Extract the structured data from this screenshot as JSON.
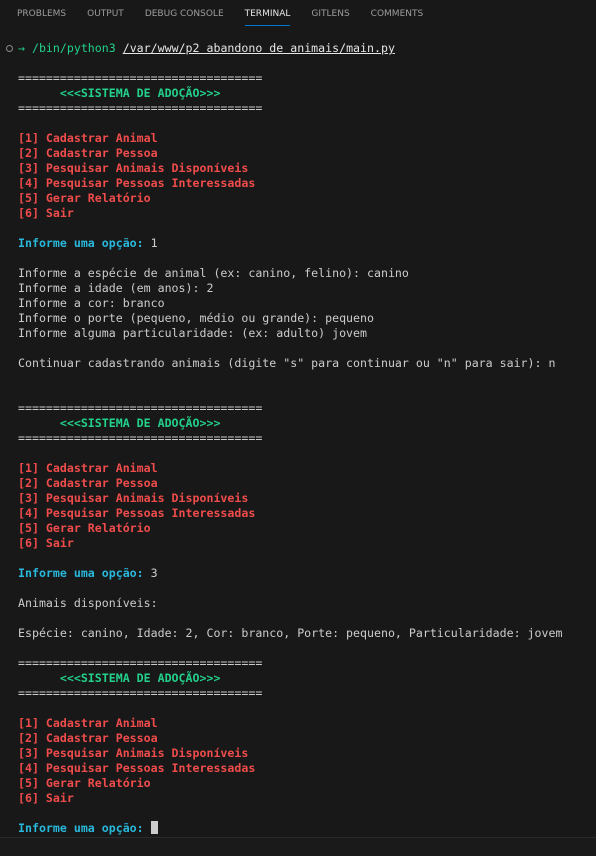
{
  "tabs": [
    "Problems",
    "Output",
    "Debug Console",
    "Terminal",
    "GitLens",
    "Comments"
  ],
  "active_tab": "Terminal",
  "prompt": {
    "arrow": "→",
    "command": "/bin/python3",
    "path": "/var/www/p2 abandono de animais/main.py"
  },
  "colors": {
    "background": "#181818",
    "title": "#23d18b",
    "menu": "#f14c4c",
    "prompt": "#29b8db",
    "text": "#cccccc",
    "active_tab_underline": "#0078d4"
  },
  "lines": [
    {
      "t": "blank",
      "text": ""
    },
    {
      "t": "sep",
      "text": "==================================="
    },
    {
      "t": "title",
      "text": "      <<<SISTEMA DE ADOÇÃO>>>"
    },
    {
      "t": "sep",
      "text": "==================================="
    },
    {
      "t": "blank",
      "text": ""
    },
    {
      "t": "menu",
      "text": "[1] Cadastrar Animal"
    },
    {
      "t": "menu",
      "text": "[2] Cadastrar Pessoa"
    },
    {
      "t": "menu",
      "text": "[3] Pesquisar Animais Disponíveis"
    },
    {
      "t": "menu",
      "text": "[4] Pesquisar Pessoas Interessadas"
    },
    {
      "t": "menu",
      "text": "[5] Gerar Relatório"
    },
    {
      "t": "menu",
      "text": "[6] Sair"
    },
    {
      "t": "blank",
      "text": ""
    },
    {
      "t": "ask",
      "text": "Informe uma opção:",
      "value": " 1"
    },
    {
      "t": "blank",
      "text": ""
    },
    {
      "t": "text",
      "text": "Informe a espécie de animal (ex: canino, felino): canino"
    },
    {
      "t": "text",
      "text": "Informe a idade (em anos): 2"
    },
    {
      "t": "text",
      "text": "Informe a cor: branco"
    },
    {
      "t": "text",
      "text": "Informe o porte (pequeno, médio ou grande): pequeno"
    },
    {
      "t": "text",
      "text": "Informe alguma particularidade: (ex: adulto) jovem"
    },
    {
      "t": "blank",
      "text": ""
    },
    {
      "t": "text",
      "text": "Continuar cadastrando animais (digite \"s\" para continuar ou \"n\" para sair): n"
    },
    {
      "t": "blank",
      "text": ""
    },
    {
      "t": "blank",
      "text": ""
    },
    {
      "t": "sep",
      "text": "==================================="
    },
    {
      "t": "title",
      "text": "      <<<SISTEMA DE ADOÇÃO>>>"
    },
    {
      "t": "sep",
      "text": "==================================="
    },
    {
      "t": "blank",
      "text": ""
    },
    {
      "t": "menu",
      "text": "[1] Cadastrar Animal"
    },
    {
      "t": "menu",
      "text": "[2] Cadastrar Pessoa"
    },
    {
      "t": "menu",
      "text": "[3] Pesquisar Animais Disponíveis"
    },
    {
      "t": "menu",
      "text": "[4] Pesquisar Pessoas Interessadas"
    },
    {
      "t": "menu",
      "text": "[5] Gerar Relatório"
    },
    {
      "t": "menu",
      "text": "[6] Sair"
    },
    {
      "t": "blank",
      "text": ""
    },
    {
      "t": "ask",
      "text": "Informe uma opção:",
      "value": " 3"
    },
    {
      "t": "blank",
      "text": ""
    },
    {
      "t": "text",
      "text": "Animais disponíveis:"
    },
    {
      "t": "blank",
      "text": ""
    },
    {
      "t": "text",
      "text": "Espécie: canino, Idade: 2, Cor: branco, Porte: pequeno, Particularidade: jovem"
    },
    {
      "t": "blank",
      "text": ""
    },
    {
      "t": "sep",
      "text": "==================================="
    },
    {
      "t": "title",
      "text": "      <<<SISTEMA DE ADOÇÃO>>>"
    },
    {
      "t": "sep",
      "text": "==================================="
    },
    {
      "t": "blank",
      "text": ""
    },
    {
      "t": "menu",
      "text": "[1] Cadastrar Animal"
    },
    {
      "t": "menu",
      "text": "[2] Cadastrar Pessoa"
    },
    {
      "t": "menu",
      "text": "[3] Pesquisar Animais Disponíveis"
    },
    {
      "t": "menu",
      "text": "[4] Pesquisar Pessoas Interessadas"
    },
    {
      "t": "menu",
      "text": "[5] Gerar Relatório"
    },
    {
      "t": "menu",
      "text": "[6] Sair"
    },
    {
      "t": "blank",
      "text": ""
    },
    {
      "t": "ask",
      "text": "Informe uma opção:",
      "value": " ",
      "cursor": true
    }
  ]
}
